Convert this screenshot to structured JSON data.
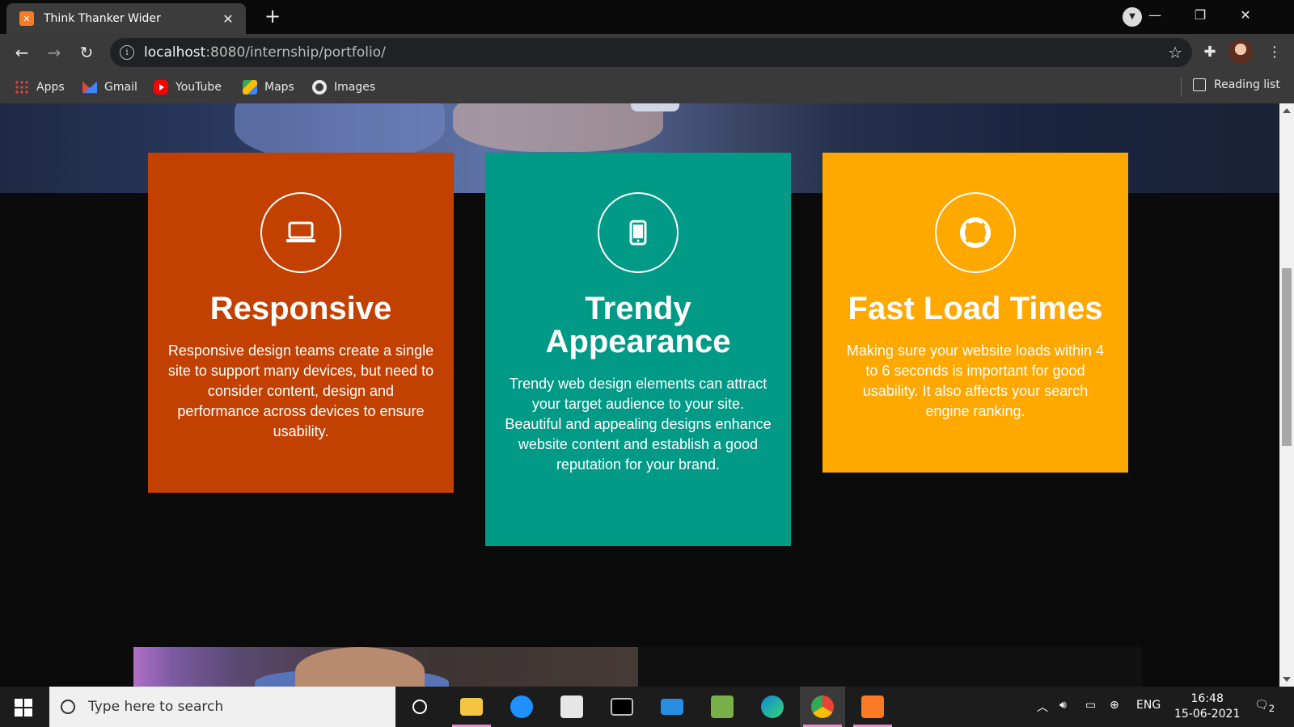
{
  "browser": {
    "tab_title": "Think Thanker Wider",
    "tab_favicon": "xampp-icon",
    "url_host": "localhost",
    "url_path": ":8080/internship/portfolio/",
    "bookmarks": [
      {
        "label": "Apps",
        "icon": "apps-icon"
      },
      {
        "label": "Gmail",
        "icon": "gmail-icon"
      },
      {
        "label": "YouTube",
        "icon": "youtube-icon"
      },
      {
        "label": "Maps",
        "icon": "maps-icon"
      },
      {
        "label": "Images",
        "icon": "images-icon"
      }
    ],
    "reading_list": "Reading list"
  },
  "features": [
    {
      "title": "Responsive",
      "text": "Responsive design teams create a single site to support many devices, but need to consider content, design and performance across devices to ensure usability.",
      "icon": "laptop-icon",
      "color": "#c24000"
    },
    {
      "title": "Trendy Appearance",
      "text": "Trendy web design elements can attract your target audience to your site. Beautiful and appealing designs enhance website content and establish a good reputation for your brand.",
      "icon": "mobile-icon",
      "color": "#009a87"
    },
    {
      "title": "Fast Load Times",
      "text": "Making sure your website loads within 4 to 6 seconds is important for good usability. It also affects your search engine ranking.",
      "icon": "life-ring-icon",
      "color": "#ffa800"
    }
  ],
  "taskbar": {
    "search_placeholder": "Type here to search",
    "language": "ENG",
    "time": "16:48",
    "date": "15-06-2021",
    "notifications": "2"
  }
}
